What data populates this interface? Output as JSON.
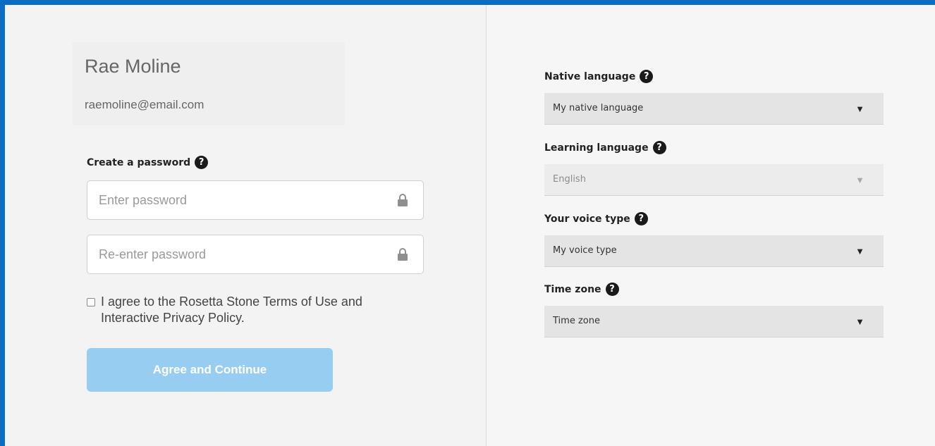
{
  "user": {
    "name": "Rae Moline",
    "email": "raemoline@email.com"
  },
  "password": {
    "label": "Create a password",
    "help_icon": "question-circle-icon",
    "enter_placeholder": "Enter password",
    "reenter_placeholder": "Re-enter password",
    "lock_icon": "lock-icon"
  },
  "agreement": {
    "text": "I agree to the Rosetta Stone Terms of Use and Interactive Privacy Policy.",
    "checked": false
  },
  "submit": {
    "label": "Agree and Continue",
    "color": "#97cdf0"
  },
  "settings": {
    "native_language": {
      "label": "Native language",
      "value": "My native language"
    },
    "learning_language": {
      "label": "Learning language",
      "value": "English",
      "disabled": true
    },
    "voice_type": {
      "label": "Your voice type",
      "value": "My voice type"
    },
    "time_zone": {
      "label": "Time zone",
      "value": "Time zone"
    },
    "dropdown_icon": "triangle-down-icon"
  },
  "colors": {
    "frame_accent": "#0a6cc2",
    "panel_background": "#f3f3f3"
  }
}
